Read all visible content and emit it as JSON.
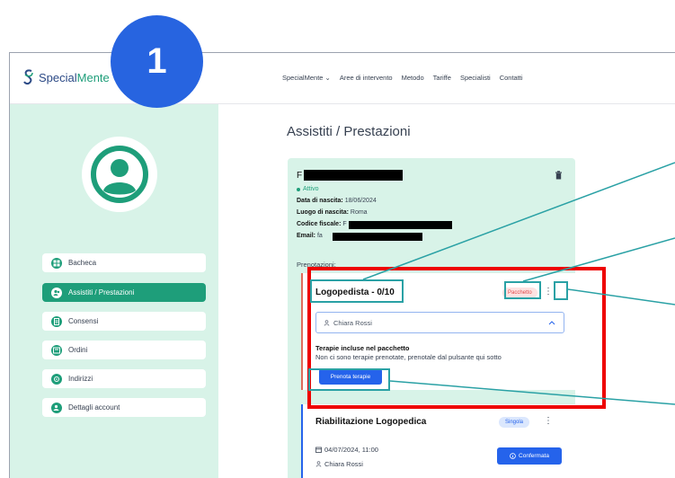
{
  "step_badge": "1",
  "logo": {
    "prefix": "Special",
    "accent": "Mente"
  },
  "nav": [
    "SpecialMente ⌄",
    "Aree di intervento",
    "Metodo",
    "Tariffe",
    "Specialisti",
    "Contatti"
  ],
  "sidebar": {
    "items": [
      {
        "label": "Bacheca",
        "active": false
      },
      {
        "label": "Assistiti / Prestazioni",
        "active": true
      },
      {
        "label": "Consensi",
        "active": false
      },
      {
        "label": "Ordini",
        "active": false
      },
      {
        "label": "Indirizzi",
        "active": false
      },
      {
        "label": "Dettagli account",
        "active": false
      }
    ]
  },
  "page_title": "Assistiti / Prestazioni",
  "patient": {
    "name_initial": "F",
    "status": "Attivo",
    "birth_date_label": "Data di nascita:",
    "birth_date": "18/06/2024",
    "birth_place_label": "Luogo di nascita:",
    "birth_place": "Roma",
    "tax_code_label": "Codice fiscale:",
    "tax_code_initial": "F",
    "email_label": "Email:",
    "email_initial": "fa"
  },
  "prenotazioni_label": "Prenotazioni:",
  "package_booking": {
    "title": "Logopedista - 0/10",
    "badge": "Pacchetto",
    "therapist": "Chiara Rossi",
    "included_title": "Terapie incluse nel pacchetto",
    "included_text": "Non ci sono terapie prenotate, prenotale dal pulsante qui sotto",
    "book_button": "Prenota terapie"
  },
  "single_booking": {
    "title": "Riabilitazione Logopedica",
    "badge": "Singola",
    "datetime": "04/07/2024, 11:00",
    "therapist": "Chiara Rossi",
    "status_button": "Confermata"
  },
  "colors": {
    "brand_green": "#1e9e7a",
    "sidebar_bg": "#d8f3e8",
    "primary_blue": "#2563eb",
    "badge_blue": "#2764e0",
    "highlight_red": "#ee0000",
    "annotation_teal": "#2aa1a5"
  }
}
